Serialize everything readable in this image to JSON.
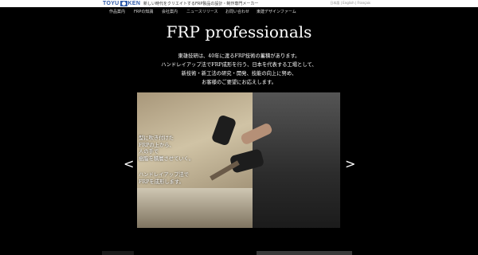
{
  "header": {
    "logo_left": "TOYU",
    "logo_right": "KEN",
    "tagline": "新しい時代をクリエイトするFRP製品の設計・制作専門メーカー",
    "languages": "日本語 | English | Français"
  },
  "nav": {
    "items": [
      "作品案内",
      "FRPの知識",
      "会社案内",
      "ニュースリリース",
      "お問い合わせ",
      "東建デザインファーム"
    ]
  },
  "hero": {
    "title": "FRP professionals",
    "intro": [
      "東雄技研は、40年に渡るFRP技術の蓄積があります。",
      "ハンドレイアップ法でFRP成形を行う、日本を代表する工場として、",
      "新技術・新工法の研究・開発、技能の向上に努め、",
      "お客様のご要望にお応えします。"
    ]
  },
  "slider": {
    "caption_a": [
      "型に吹き付けた",
      "FRPの上から、",
      "人の手で",
      "樹脂を積層させていく。"
    ],
    "caption_b": [
      "ハンドレイアップ法で",
      "FRPを成形します。"
    ],
    "prev": "<",
    "next": ">",
    "prev_icon": "chevron-left-icon",
    "next_icon": "chevron-right-icon"
  },
  "colors": {
    "background": "#000000",
    "logo_blue": "#2f5aa8",
    "text": "#ffffff"
  }
}
